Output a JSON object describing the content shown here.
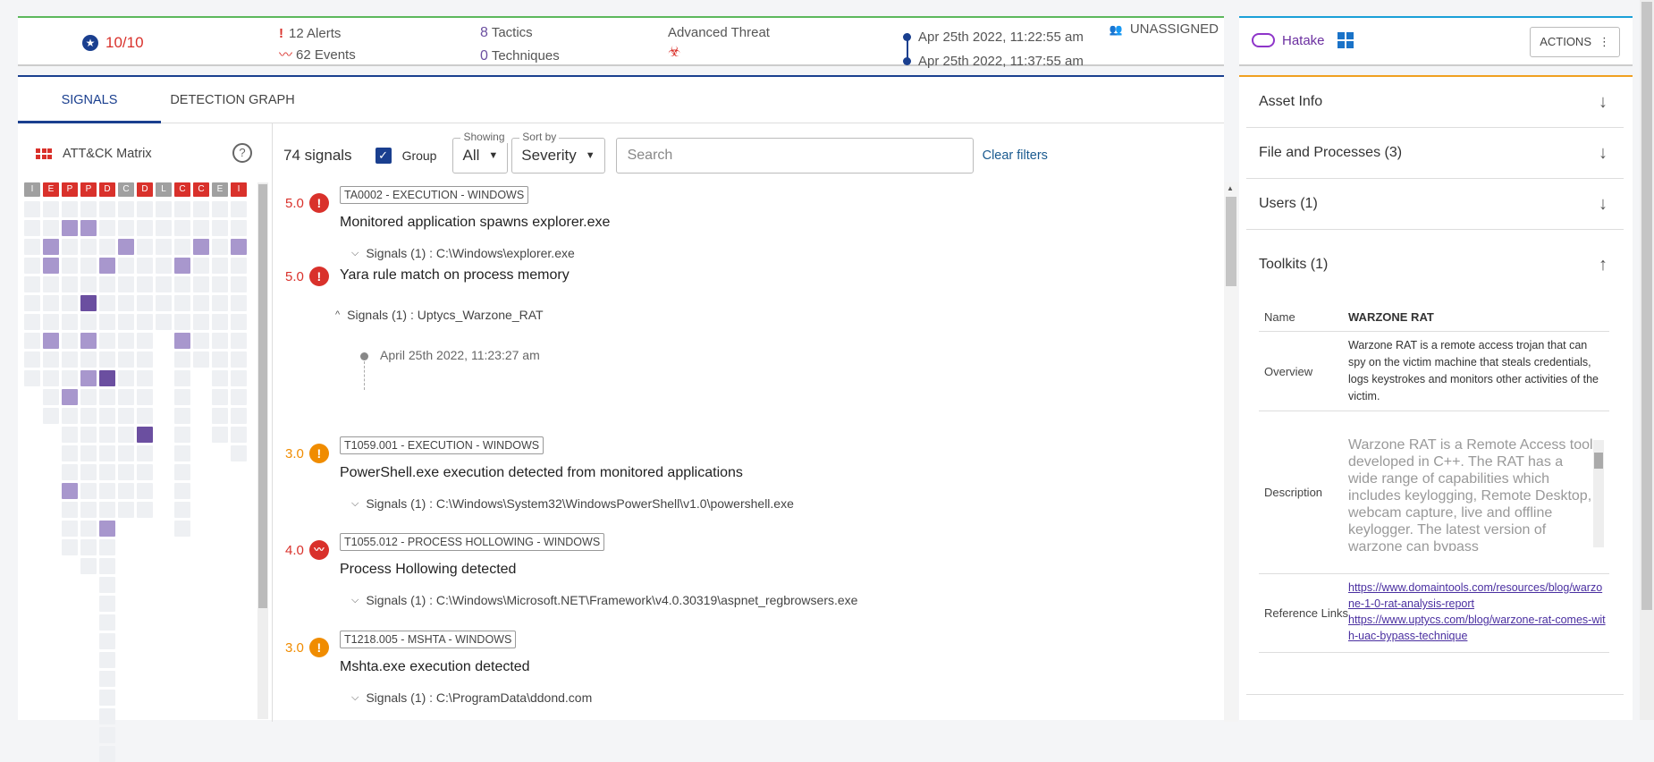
{
  "header": {
    "score": "10/10",
    "alerts": "12 Alerts",
    "events": "62 Events",
    "tactics_num": "8",
    "tactics_label": "Tactics",
    "techniques_num": "0",
    "techniques_label": "Techniques",
    "threat_type": "Advanced Threat",
    "time_start": "Apr 25th 2022, 11:22:55 am",
    "time_end": "Apr 25th 2022, 11:37:55 am",
    "assignee": "UNASSIGNED"
  },
  "host": {
    "name": "Hatake",
    "actions_label": "ACTIONS"
  },
  "tabs": [
    {
      "label": "SIGNALS"
    },
    {
      "label": "DETECTION GRAPH"
    }
  ],
  "matrix": {
    "title": "ATT&CK Matrix",
    "help": "?",
    "headers": [
      "I",
      "E",
      "P",
      "P",
      "D",
      "C",
      "D",
      "L",
      "C",
      "C",
      "E",
      "I"
    ],
    "header_colors": [
      "#a0a0a0",
      "#d9312b",
      "#d9312b",
      "#d9312b",
      "#d9312b",
      "#a0a0a0",
      "#d9312b",
      "#a0a0a0",
      "#d9312b",
      "#d9312b",
      "#a0a0a0",
      "#d9312b"
    ],
    "column_heights": [
      10,
      12,
      19,
      20,
      30,
      17,
      17,
      7,
      18,
      9,
      13,
      14
    ],
    "column_starts": [
      0,
      0,
      0,
      0,
      0,
      0,
      0,
      0,
      0,
      0,
      0,
      0
    ],
    "column_offsets": [
      0,
      1,
      1,
      1,
      1,
      1,
      1,
      1,
      1,
      1,
      1,
      1
    ],
    "highlights": {
      "1": [
        2,
        3,
        7
      ],
      "2": [
        1,
        10,
        15
      ],
      "3": [
        1,
        5,
        7,
        9
      ],
      "4": [
        3,
        9,
        17
      ],
      "5": [
        2
      ],
      "6": [
        12
      ],
      "8": [
        3,
        7
      ],
      "9": [
        2
      ],
      "11": [
        2
      ]
    },
    "dark": {
      "3": [
        5
      ],
      "4": [
        9
      ],
      "6": [
        12
      ]
    }
  },
  "filters": {
    "count": "74 signals",
    "group_label": "Group",
    "showing_label": "Showing",
    "showing_value": "All",
    "sortby_label": "Sort by",
    "sortby_value": "Severity",
    "search_placeholder": "Search",
    "clear_label": "Clear filters"
  },
  "signals": [
    {
      "severity": "5.0",
      "level": "red",
      "icon": "exclamation-icon",
      "tag": "TA0002 - EXECUTION - WINDOWS",
      "title": "Monitored application spawns explorer.exe",
      "detail": "Signals (1) : C:\\Windows\\explorer.exe",
      "expanded": false
    },
    {
      "severity": "5.0",
      "level": "red",
      "icon": "exclamation-icon",
      "tag": "",
      "title": "Yara rule match on process memory",
      "detail": "Signals (1) : Uptycs_Warzone_RAT",
      "expanded": true,
      "timestamp": "April 25th 2022, 11:23:27 am"
    },
    {
      "severity": "3.0",
      "level": "orange",
      "icon": "exclamation-icon",
      "tag": "T1059.001 - EXECUTION - WINDOWS",
      "title": "PowerShell.exe execution detected from monitored applications",
      "detail": "Signals (1) : C:\\Windows\\System32\\WindowsPowerShell\\v1.0\\powershell.exe",
      "expanded": false
    },
    {
      "severity": "4.0",
      "level": "red",
      "icon": "pulse-icon",
      "tag": "T1055.012 - PROCESS HOLLOWING - WINDOWS",
      "title": "Process Hollowing detected",
      "detail": "Signals (1) : C:\\Windows\\Microsoft.NET\\Framework\\v4.0.30319\\aspnet_regbrowsers.exe",
      "expanded": false
    },
    {
      "severity": "3.0",
      "level": "orange",
      "icon": "exclamation-icon",
      "tag": "T1218.005 - MSHTA - WINDOWS",
      "title": "Mshta.exe execution detected",
      "detail": "Signals (1) : C:\\ProgramData\\ddond.com",
      "expanded": false
    }
  ],
  "sidebar": {
    "sections": [
      {
        "label": "Asset Info"
      },
      {
        "label": "File and Processes (3)"
      },
      {
        "label": "Users (1)"
      },
      {
        "label": "Toolkits (1)"
      }
    ],
    "toolkit": {
      "name_key": "Name",
      "name_value": "WARZONE RAT",
      "overview_key": "Overview",
      "overview_value": "Warzone RAT is a remote access trojan that can spy on the victim machine that steals credentials, logs keystrokes and monitors other activities of the victim.",
      "description_key": "Description",
      "description_value": "Warzone RAT is a Remote Access tool developed in C++. The RAT has a wide range of capabilities which includes keylogging, Remote Desktop, webcam capture, live and offline keylogger. The latest version of warzone can bypass",
      "links_key": "Reference Links",
      "link1": "https://www.domaintools.com/resources/blog/warzone-1-0-rat-analysis-report",
      "link2": "https://www.uptycs.com/blog/warzone-rat-comes-with-uac-bypass-technique"
    }
  }
}
